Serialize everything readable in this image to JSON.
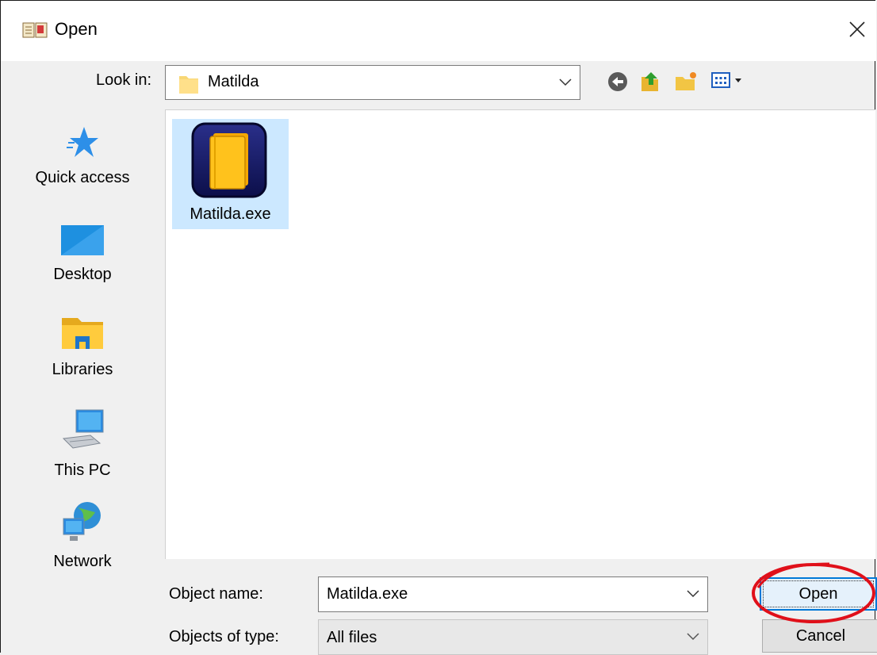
{
  "window": {
    "title": "Open"
  },
  "toolbar": {
    "look_in_label": "Look in:",
    "look_in_value": "Matilda"
  },
  "sidebar": {
    "items": [
      {
        "label": "Quick access"
      },
      {
        "label": "Desktop"
      },
      {
        "label": "Libraries"
      },
      {
        "label": "This PC"
      },
      {
        "label": "Network"
      }
    ]
  },
  "files": [
    {
      "name": "Matilda.exe"
    }
  ],
  "bottom": {
    "object_name_label": "Object name:",
    "object_name_value": "Matilda.exe",
    "objects_type_label": "Objects of type:",
    "objects_type_value": "All files",
    "open_label": "Open",
    "cancel_label": "Cancel"
  },
  "colors": {
    "selection": "#cce8ff",
    "accent": "#0078d7",
    "annotation": "#e0101a"
  }
}
